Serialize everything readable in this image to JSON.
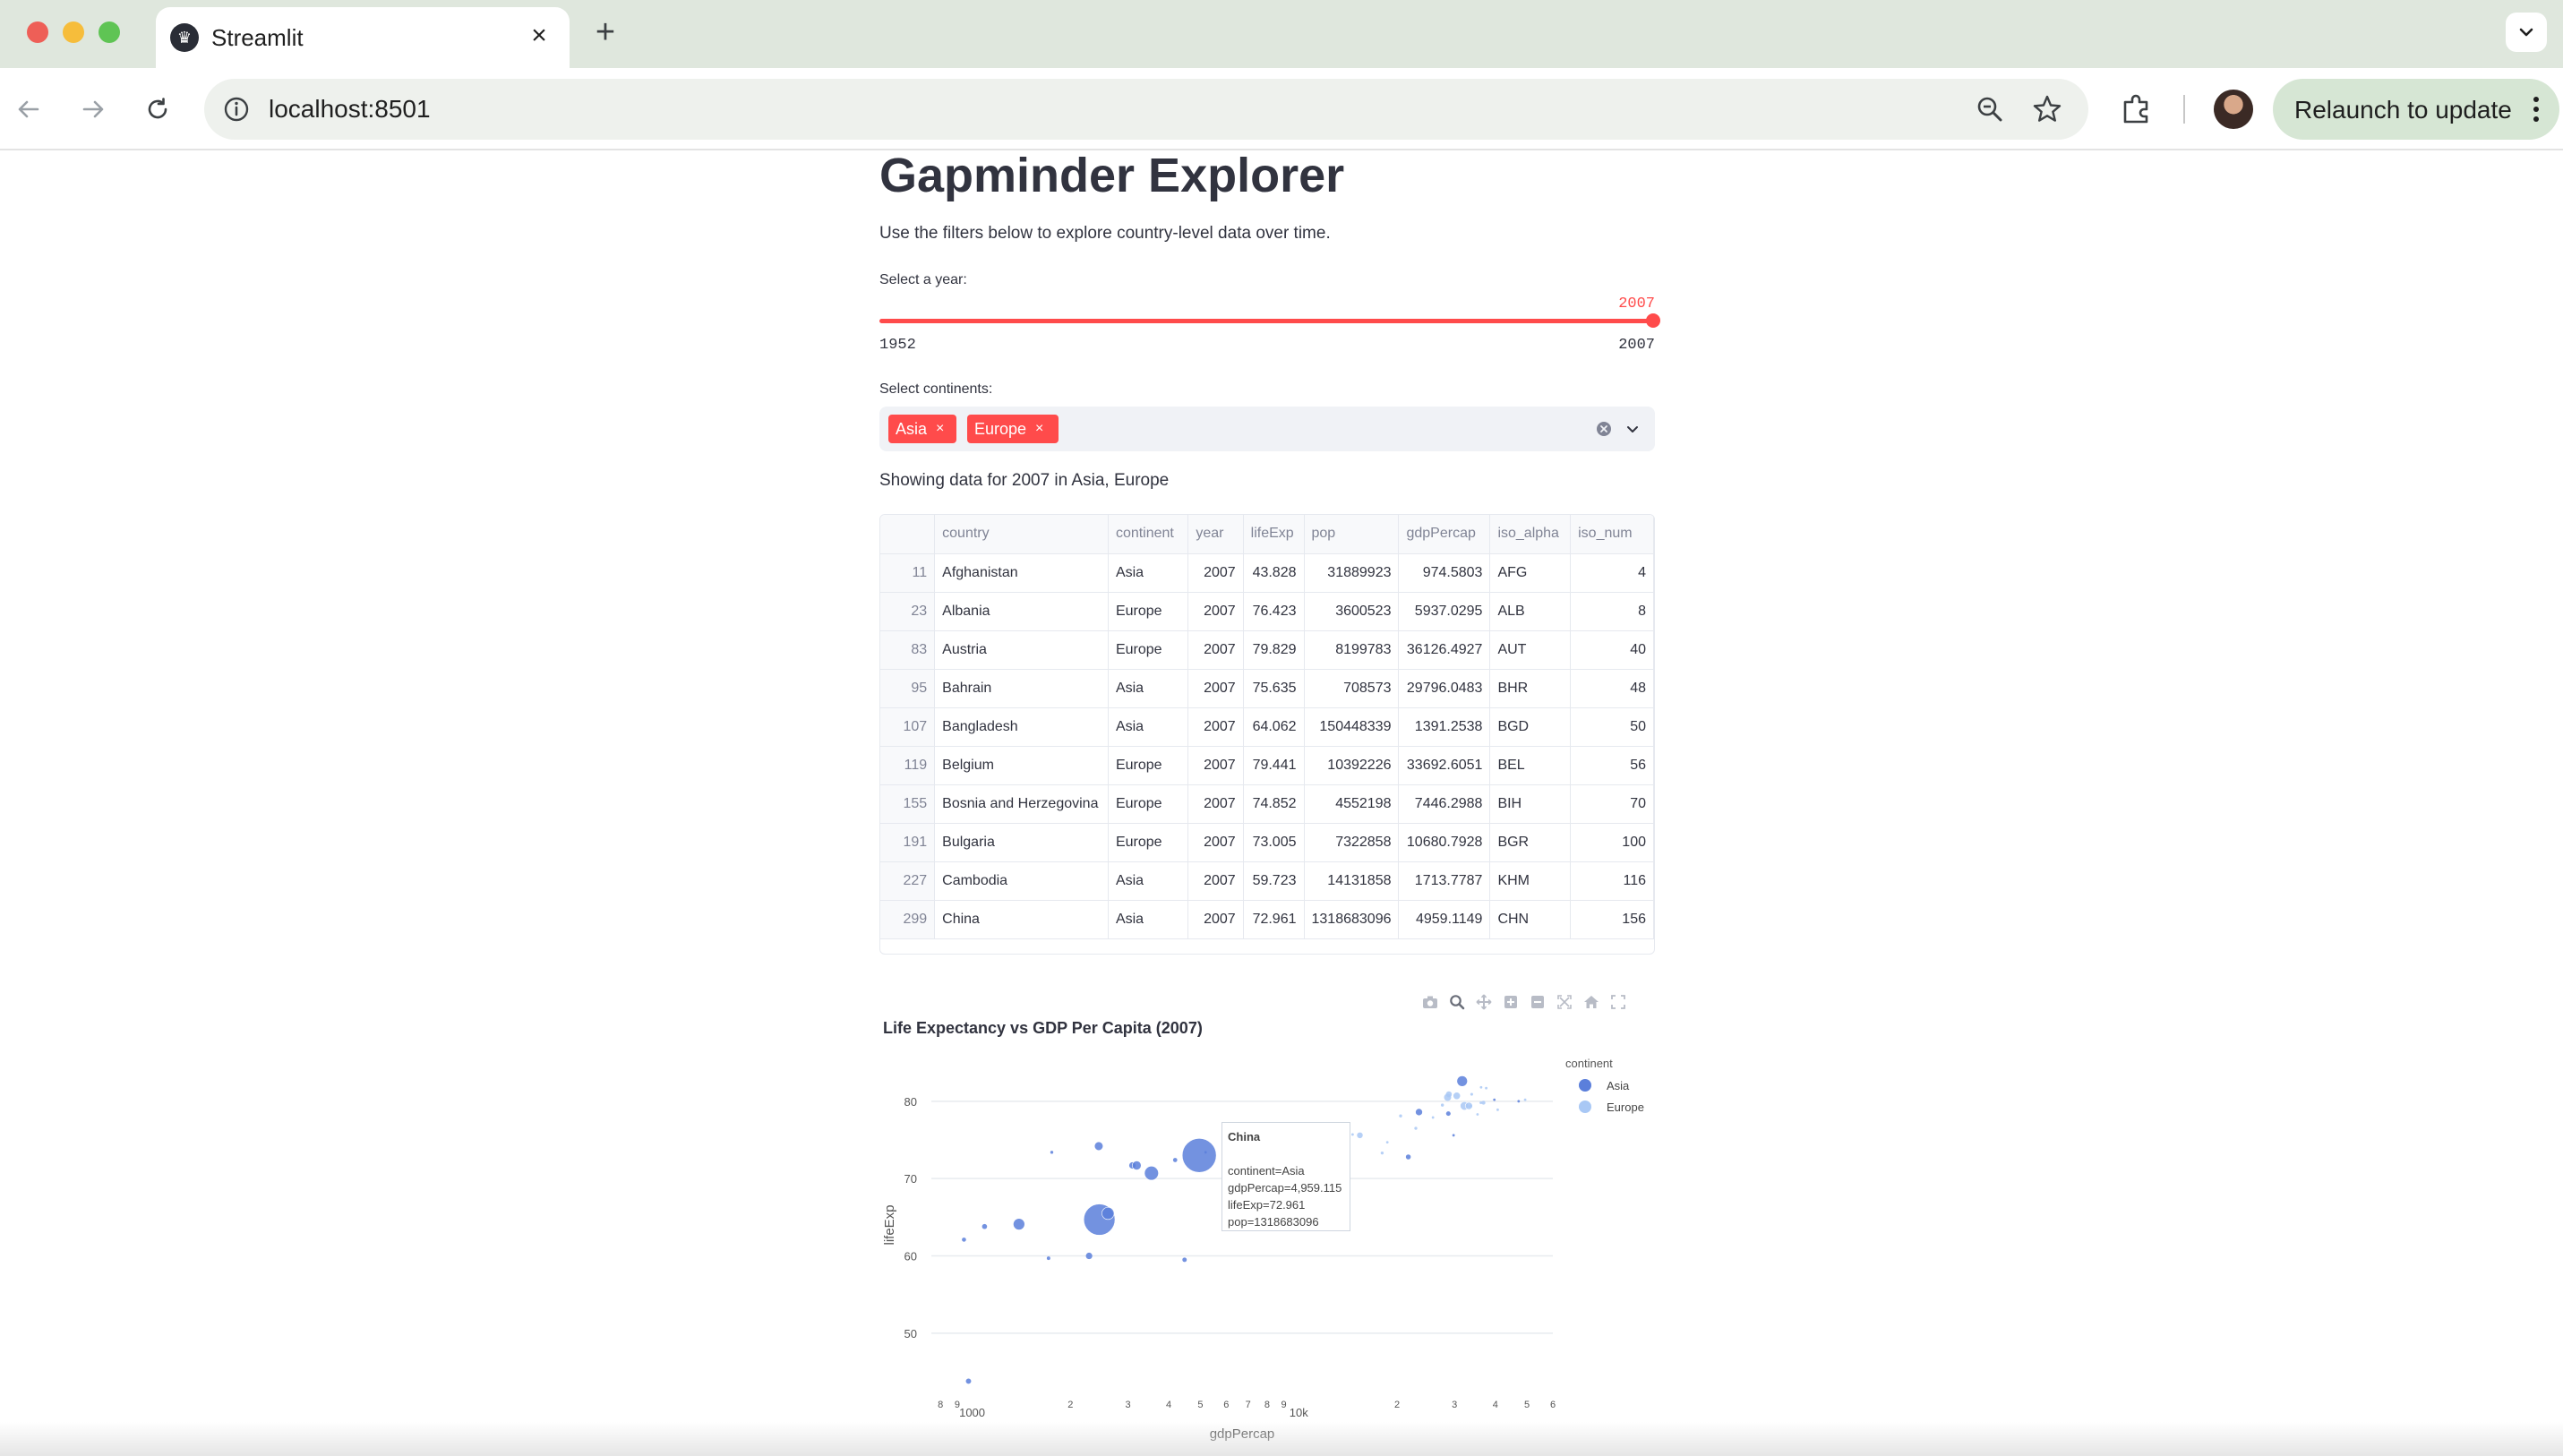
{
  "browser": {
    "tab_title": "Streamlit",
    "new_tab_symbol": "+",
    "tab_close_symbol": "×",
    "url": "localhost:8501",
    "relaunch_label": "Relaunch to update"
  },
  "app": {
    "title": "Gapminder Explorer",
    "intro": "Use the filters below to explore country-level data over time.",
    "slider": {
      "label": "Select a year:",
      "value": "2007",
      "min": "1952",
      "max": "2007",
      "fill_fraction": 1.0
    },
    "multiselect": {
      "label": "Select continents:",
      "chips": [
        "Asia",
        "Europe"
      ],
      "chip_remove_symbol": "×"
    },
    "status": "Showing data for 2007 in Asia, Europe",
    "table": {
      "columns": [
        "",
        "country",
        "continent",
        "year",
        "lifeExp",
        "pop",
        "gdpPercap",
        "iso_alpha",
        "iso_num"
      ],
      "rows": [
        [
          "11",
          "Afghanistan",
          "Asia",
          "2007",
          "43.828",
          "31889923",
          "974.5803",
          "AFG",
          "4"
        ],
        [
          "23",
          "Albania",
          "Europe",
          "2007",
          "76.423",
          "3600523",
          "5937.0295",
          "ALB",
          "8"
        ],
        [
          "83",
          "Austria",
          "Europe",
          "2007",
          "79.829",
          "8199783",
          "36126.4927",
          "AUT",
          "40"
        ],
        [
          "95",
          "Bahrain",
          "Asia",
          "2007",
          "75.635",
          "708573",
          "29796.0483",
          "BHR",
          "48"
        ],
        [
          "107",
          "Bangladesh",
          "Asia",
          "2007",
          "64.062",
          "150448339",
          "1391.2538",
          "BGD",
          "50"
        ],
        [
          "119",
          "Belgium",
          "Europe",
          "2007",
          "79.441",
          "10392226",
          "33692.6051",
          "BEL",
          "56"
        ],
        [
          "155",
          "Bosnia and Herzegovina",
          "Europe",
          "2007",
          "74.852",
          "4552198",
          "7446.2988",
          "BIH",
          "70"
        ],
        [
          "191",
          "Bulgaria",
          "Europe",
          "2007",
          "73.005",
          "7322858",
          "10680.7928",
          "BGR",
          "100"
        ],
        [
          "227",
          "Cambodia",
          "Asia",
          "2007",
          "59.723",
          "14131858",
          "1713.7787",
          "KHM",
          "116"
        ],
        [
          "299",
          "China",
          "Asia",
          "2007",
          "72.961",
          "1318683096",
          "4959.1149",
          "CHN",
          "156"
        ]
      ]
    }
  },
  "colors": {
    "accent": "#ff4b4b",
    "asia": "#5b7fdb",
    "europe": "#a9c8f5",
    "text": "#31333f"
  },
  "chart_data": {
    "type": "scatter",
    "title": "Life Expectancy vs GDP Per Capita (2007)",
    "xlabel": "gdpPercap",
    "ylabel": "lifeExp",
    "x_scale": "log",
    "xlim": [
      750,
      60000
    ],
    "ylim": [
      42,
      86
    ],
    "x_ticks": [
      {
        "v": 800,
        "label": "8"
      },
      {
        "v": 900,
        "label": "9"
      },
      {
        "v": 1000,
        "label": "1000"
      },
      {
        "v": 2000,
        "label": "2"
      },
      {
        "v": 3000,
        "label": "3"
      },
      {
        "v": 4000,
        "label": "4"
      },
      {
        "v": 5000,
        "label": "5"
      },
      {
        "v": 6000,
        "label": "6"
      },
      {
        "v": 7000,
        "label": "7"
      },
      {
        "v": 8000,
        "label": "8"
      },
      {
        "v": 9000,
        "label": "9"
      },
      {
        "v": 10000,
        "label": "10k"
      },
      {
        "v": 20000,
        "label": "2"
      },
      {
        "v": 30000,
        "label": "3"
      },
      {
        "v": 40000,
        "label": "4"
      },
      {
        "v": 50000,
        "label": "5"
      },
      {
        "v": 60000,
        "label": "6"
      }
    ],
    "y_ticks": [
      50,
      60,
      70,
      80
    ],
    "legend": {
      "title": "continent",
      "position": "top-right",
      "entries": [
        "Asia",
        "Europe"
      ]
    },
    "series": [
      {
        "name": "Asia",
        "color": "#5b7fdb",
        "points": [
          {
            "x": 974.6,
            "y": 43.8,
            "pop": 31889923
          },
          {
            "x": 29796,
            "y": 75.6,
            "pop": 708573
          },
          {
            "x": 1391.3,
            "y": 64.1,
            "pop": 150448339
          },
          {
            "x": 1713.8,
            "y": 59.7,
            "pop": 14131858
          },
          {
            "x": 4959.1,
            "y": 73.0,
            "pop": 1318683096
          },
          {
            "x": 2452.2,
            "y": 64.7,
            "pop": 1110396331
          },
          {
            "x": 3540.7,
            "y": 70.7,
            "pop": 223547000
          },
          {
            "x": 31656,
            "y": 82.6,
            "pop": 127467972
          },
          {
            "x": 39725,
            "y": 80.2,
            "pop": 6980412
          },
          {
            "x": 23348,
            "y": 78.6,
            "pop": 49044790
          },
          {
            "x": 3095.8,
            "y": 71.7,
            "pop": 47761980
          },
          {
            "x": 7458.4,
            "y": 74.2,
            "pop": 65068149
          },
          {
            "x": 944.0,
            "y": 62.1,
            "pop": 19951656
          },
          {
            "x": 1091.4,
            "y": 63.8,
            "pop": 28901790
          },
          {
            "x": 2605.9,
            "y": 65.5,
            "pop": 169270617
          },
          {
            "x": 3190.5,
            "y": 71.7,
            "pop": 91077287
          },
          {
            "x": 2441.6,
            "y": 74.2,
            "pop": 85262356
          },
          {
            "x": 4184.5,
            "y": 72.4,
            "pop": 20378239
          },
          {
            "x": 47143,
            "y": 80.0,
            "pop": 4553009
          },
          {
            "x": 12451.7,
            "y": 74.2,
            "pop": 24821286
          },
          {
            "x": 2280.8,
            "y": 60.0,
            "pop": 47761980
          },
          {
            "x": 4471.1,
            "y": 59.5,
            "pop": 22211743
          },
          {
            "x": 11605.7,
            "y": 71.4,
            "pop": 2505559
          },
          {
            "x": 21654.8,
            "y": 72.8,
            "pop": 27601038
          },
          {
            "x": 28718.3,
            "y": 78.4,
            "pop": 23174294
          },
          {
            "x": 5186.1,
            "y": 73.4,
            "pop": 6426679
          },
          {
            "x": 1753.3,
            "y": 73.4,
            "pop": 10276158
          }
        ]
      },
      {
        "name": "Europe",
        "color": "#a9c8f5",
        "points": [
          {
            "x": 5937.0,
            "y": 76.4,
            "pop": 3600523
          },
          {
            "x": 36126.5,
            "y": 79.8,
            "pop": 8199783
          },
          {
            "x": 33692.6,
            "y": 79.4,
            "pop": 10392226
          },
          {
            "x": 7446.3,
            "y": 74.9,
            "pop": 4552198
          },
          {
            "x": 10680.8,
            "y": 73.0,
            "pop": 7322858
          },
          {
            "x": 14619.2,
            "y": 75.7,
            "pop": 4493312
          },
          {
            "x": 22833.3,
            "y": 76.5,
            "pop": 10228744
          },
          {
            "x": 35278.4,
            "y": 78.3,
            "pop": 5468120
          },
          {
            "x": 33207.1,
            "y": 79.3,
            "pop": 5238460
          },
          {
            "x": 30470.0,
            "y": 80.7,
            "pop": 61083916
          },
          {
            "x": 32170.4,
            "y": 79.4,
            "pop": 82400996
          },
          {
            "x": 27538.4,
            "y": 79.5,
            "pop": 10706290
          },
          {
            "x": 18008.9,
            "y": 73.3,
            "pop": 9956108
          },
          {
            "x": 36181.0,
            "y": 81.8,
            "pop": 301931
          },
          {
            "x": 40676.0,
            "y": 78.9,
            "pop": 4109086
          },
          {
            "x": 28569.7,
            "y": 80.5,
            "pop": 58147733
          },
          {
            "x": 9253.9,
            "y": 74.5,
            "pop": 684736
          },
          {
            "x": 36798.0,
            "y": 79.8,
            "pop": 16570613
          },
          {
            "x": 49357.2,
            "y": 80.2,
            "pop": 4627926
          },
          {
            "x": 15389.9,
            "y": 75.6,
            "pop": 38518241
          },
          {
            "x": 20509.6,
            "y": 78.1,
            "pop": 10642836
          },
          {
            "x": 10808.5,
            "y": 72.5,
            "pop": 22276056
          },
          {
            "x": 9786.5,
            "y": 74.0,
            "pop": 10150265
          },
          {
            "x": 18678.3,
            "y": 74.7,
            "pop": 5447502
          },
          {
            "x": 25768.3,
            "y": 77.9,
            "pop": 2009245
          },
          {
            "x": 28821.1,
            "y": 80.9,
            "pop": 40448191
          },
          {
            "x": 33859.7,
            "y": 80.9,
            "pop": 9031088
          },
          {
            "x": 37506.4,
            "y": 81.7,
            "pop": 7554661
          },
          {
            "x": 8458.3,
            "y": 71.8,
            "pop": 71158647
          },
          {
            "x": 33203.3,
            "y": 79.4,
            "pop": 60776238
          }
        ]
      }
    ],
    "hover": {
      "title": "China",
      "lines": [
        "continent=Asia",
        "gdpPercap=4,959.115",
        "lifeExp=72.961",
        "pop=1318683096"
      ]
    }
  }
}
